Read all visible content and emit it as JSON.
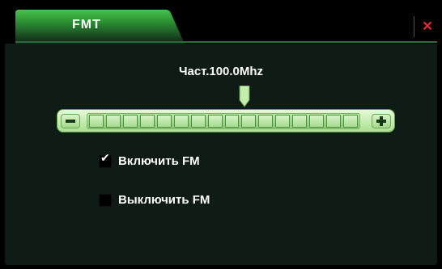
{
  "tab": {
    "label": "FMT"
  },
  "close": {
    "symbol": "×"
  },
  "frequency": {
    "label": "Част.100.0Mhz",
    "position": 0.58
  },
  "slider": {
    "minus_label": "−",
    "plus_label": "+"
  },
  "options": [
    {
      "label": "Включить FM",
      "checked": true
    },
    {
      "label": "Выключить FM",
      "checked": false
    }
  ],
  "colors": {
    "accent": "#3aa33f",
    "close": "#e02a2a",
    "background": "#0f1c16"
  }
}
